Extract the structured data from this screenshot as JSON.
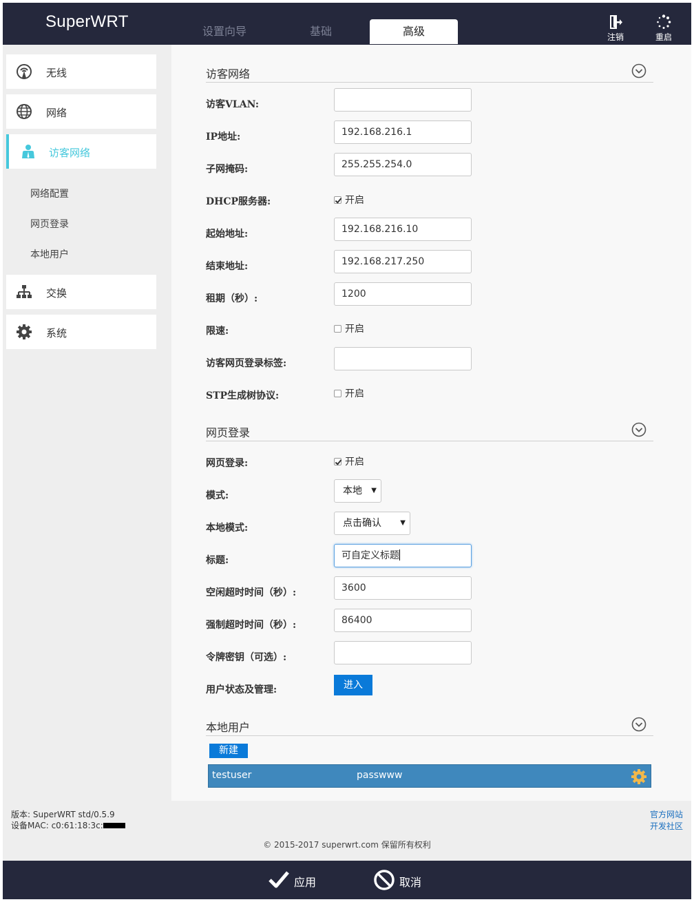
{
  "header": {
    "logo": "SuperWRT",
    "tabs": [
      {
        "label": "设置向导"
      },
      {
        "label": "基础"
      },
      {
        "label": "高级"
      }
    ],
    "logout_label": "注销",
    "reboot_label": "重启"
  },
  "sidebar": {
    "items": [
      {
        "label": "无线",
        "icon": "wifi-signal-icon"
      },
      {
        "label": "网络",
        "icon": "globe-icon"
      },
      {
        "label": "访客网络",
        "icon": "guest-user-icon"
      },
      {
        "label": "交换",
        "icon": "switch-network-icon"
      },
      {
        "label": "系统",
        "icon": "gear-icon"
      }
    ],
    "sub_items": [
      {
        "label": "网络配置"
      },
      {
        "label": "网页登录"
      },
      {
        "label": "本地用户"
      }
    ],
    "active_color": "#46c8dc"
  },
  "guest": {
    "title": "访客网络",
    "vlan_label": "访客VLAN:",
    "vlan_value": "",
    "ip_label": "IP地址:",
    "ip_value": "192.168.216.1",
    "mask_label": "子网掩码:",
    "mask_value": "255.255.254.0",
    "dhcp_label": "DHCP服务器:",
    "dhcp_check": "开启",
    "start_label": "起始地址:",
    "start_value": "192.168.216.10",
    "end_label": "结束地址:",
    "end_value": "192.168.217.250",
    "lease_label": "租期（秒）:",
    "lease_value": "1200",
    "limit_label": "限速:",
    "limit_check": "开启",
    "tag_label": "访客网页登录标签:",
    "tag_value": "",
    "stp_label": "STP生成树协议:",
    "stp_check": "开启"
  },
  "portal": {
    "title": "网页登录",
    "enable_label": "网页登录:",
    "enable_check": "开启",
    "mode_label": "模式:",
    "mode_value": "本地",
    "local_mode_label": "本地模式:",
    "local_mode_value": "点击确认",
    "caption_label": "标题:",
    "caption_value": "可自定义标题",
    "idle_label": "空闲超时时间（秒）:",
    "idle_value": "3600",
    "force_label": "强制超时时间（秒）:",
    "force_value": "86400",
    "token_label": "令牌密钥（可选）:",
    "token_value": "",
    "status_label": "用户状态及管理:",
    "enter_button": "进入"
  },
  "local_users": {
    "title": "本地用户",
    "new_button": "新建",
    "users": [
      {
        "username": "testuser",
        "password": "passwww"
      }
    ]
  },
  "footer": {
    "version": "版本: SuperWRT std/0.5.9",
    "mac": "设备MAC: c0:61:18:3c:",
    "link_official": "官方网站",
    "link_dev": "开发社区",
    "copyright": "© 2015-2017 superwrt.com 保留所有权利"
  },
  "actions": {
    "apply": "应用",
    "cancel": "取消"
  }
}
